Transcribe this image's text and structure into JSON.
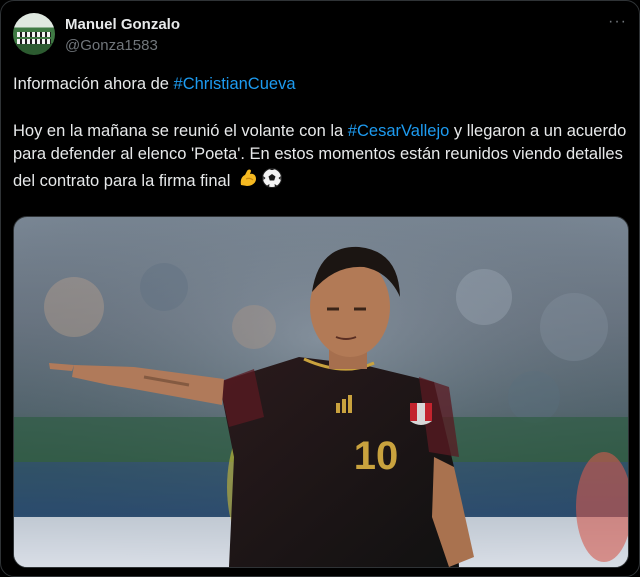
{
  "author": {
    "name": "Manuel Gonzalo",
    "handle": "@Gonza1583",
    "avatar_icon": "team-photo-avatar"
  },
  "more_icon": "more-options-icon",
  "more_glyph": "···",
  "tweet": {
    "line1_prefix": "Información ahora de ",
    "line1_hashtag": "#ChristianCueva",
    "p2_part1": "Hoy en la mañana se reunió el volante con la ",
    "p2_hashtag": "#CesarVallejo",
    "p2_part2": " y llegaron a un acuerdo para defender al elenco 'Poeta'. En estos momentos están reunidos viendo detalles del contrato para la firma final "
  },
  "media": {
    "description_icon": "football-player-photo",
    "jersey_number": "10"
  },
  "colors": {
    "background": "#000000",
    "text": "#e7e9ea",
    "secondary": "#71767b",
    "hashtag": "#1d9bf0",
    "border": "#2f3336"
  }
}
